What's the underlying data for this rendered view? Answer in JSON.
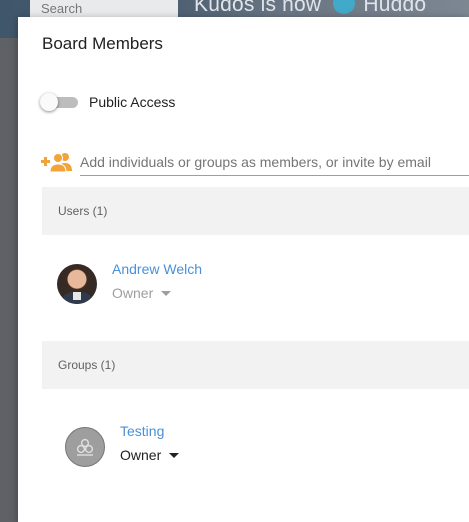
{
  "background": {
    "search_placeholder": "Search",
    "banner_text": "Kudos is now",
    "brand_text": "Huddo"
  },
  "dialog": {
    "title": "Board Members",
    "public_access": {
      "label": "Public Access",
      "enabled": false
    },
    "add_members": {
      "icon": "add-person-icon",
      "placeholder": "Add individuals or groups as members, or invite by email",
      "value": ""
    },
    "users_section": {
      "header": "Users (1)",
      "items": [
        {
          "name": "Andrew Welch",
          "role": "Owner",
          "role_enabled": false
        }
      ]
    },
    "groups_section": {
      "header": "Groups (1)",
      "items": [
        {
          "name": "Testing",
          "role": "Owner",
          "role_enabled": true,
          "icon": "group-icon"
        }
      ]
    }
  },
  "colors": {
    "accent_orange": "#f2a33a",
    "link_blue": "#4a90d9",
    "section_bg": "#f2f2f2",
    "disabled_text": "#9e9e9e"
  }
}
